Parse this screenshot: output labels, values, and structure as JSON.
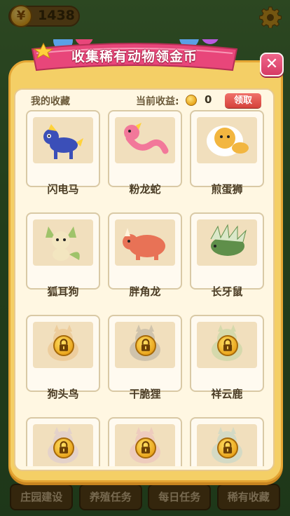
{
  "hud": {
    "coins": "1438",
    "coin_symbol": "¥"
  },
  "modal": {
    "title": "收集稀有动物领金币",
    "close_label": "✕",
    "my_collection_label": "我的收藏",
    "earnings_label": "当前收益:",
    "earnings_value": "0",
    "claim_label": "领取"
  },
  "animals": [
    {
      "name": "闪电马",
      "locked": false,
      "icon": "lightning-horse-icon",
      "color": "#3b4fb8"
    },
    {
      "name": "粉龙蛇",
      "locked": false,
      "icon": "pink-dragon-snake-icon",
      "color": "#f2789a"
    },
    {
      "name": "煎蛋狮",
      "locked": false,
      "icon": "fried-egg-lion-icon",
      "color": "#f2b640"
    },
    {
      "name": "狐耳狗",
      "locked": false,
      "icon": "fox-eared-dog-icon",
      "color": "#9fc36a"
    },
    {
      "name": "胖角龙",
      "locked": false,
      "icon": "chubby-triceratops-icon",
      "color": "#e87256"
    },
    {
      "name": "长牙鼠",
      "locked": false,
      "icon": "tusk-porcupine-icon",
      "color": "#5f8f4a"
    },
    {
      "name": "狗头鸟",
      "locked": true,
      "icon": "dog-head-bird-icon",
      "color": "#e7a85a"
    },
    {
      "name": "干脆狸",
      "locked": true,
      "icon": "raccoon-icon",
      "color": "#8a8a8a"
    },
    {
      "name": "祥云鹿",
      "locked": true,
      "icon": "cloud-deer-icon",
      "color": "#9ccc8a"
    },
    {
      "name": "",
      "locked": true,
      "icon": "locked-animal-icon",
      "color": "#c9b8e6"
    },
    {
      "name": "",
      "locked": true,
      "icon": "locked-animal-icon",
      "color": "#e8a6c0"
    },
    {
      "name": "",
      "locked": true,
      "icon": "locked-animal-icon",
      "color": "#9ad0d6"
    }
  ],
  "bottom_tabs": [
    {
      "label": "庄园建设"
    },
    {
      "label": "养殖任务"
    },
    {
      "label": "每日任务"
    },
    {
      "label": "稀有收藏"
    }
  ],
  "colors": {
    "modal_bg": "#f4cf66",
    "ribbon": "#e8467a",
    "claim": "#d5423b"
  }
}
